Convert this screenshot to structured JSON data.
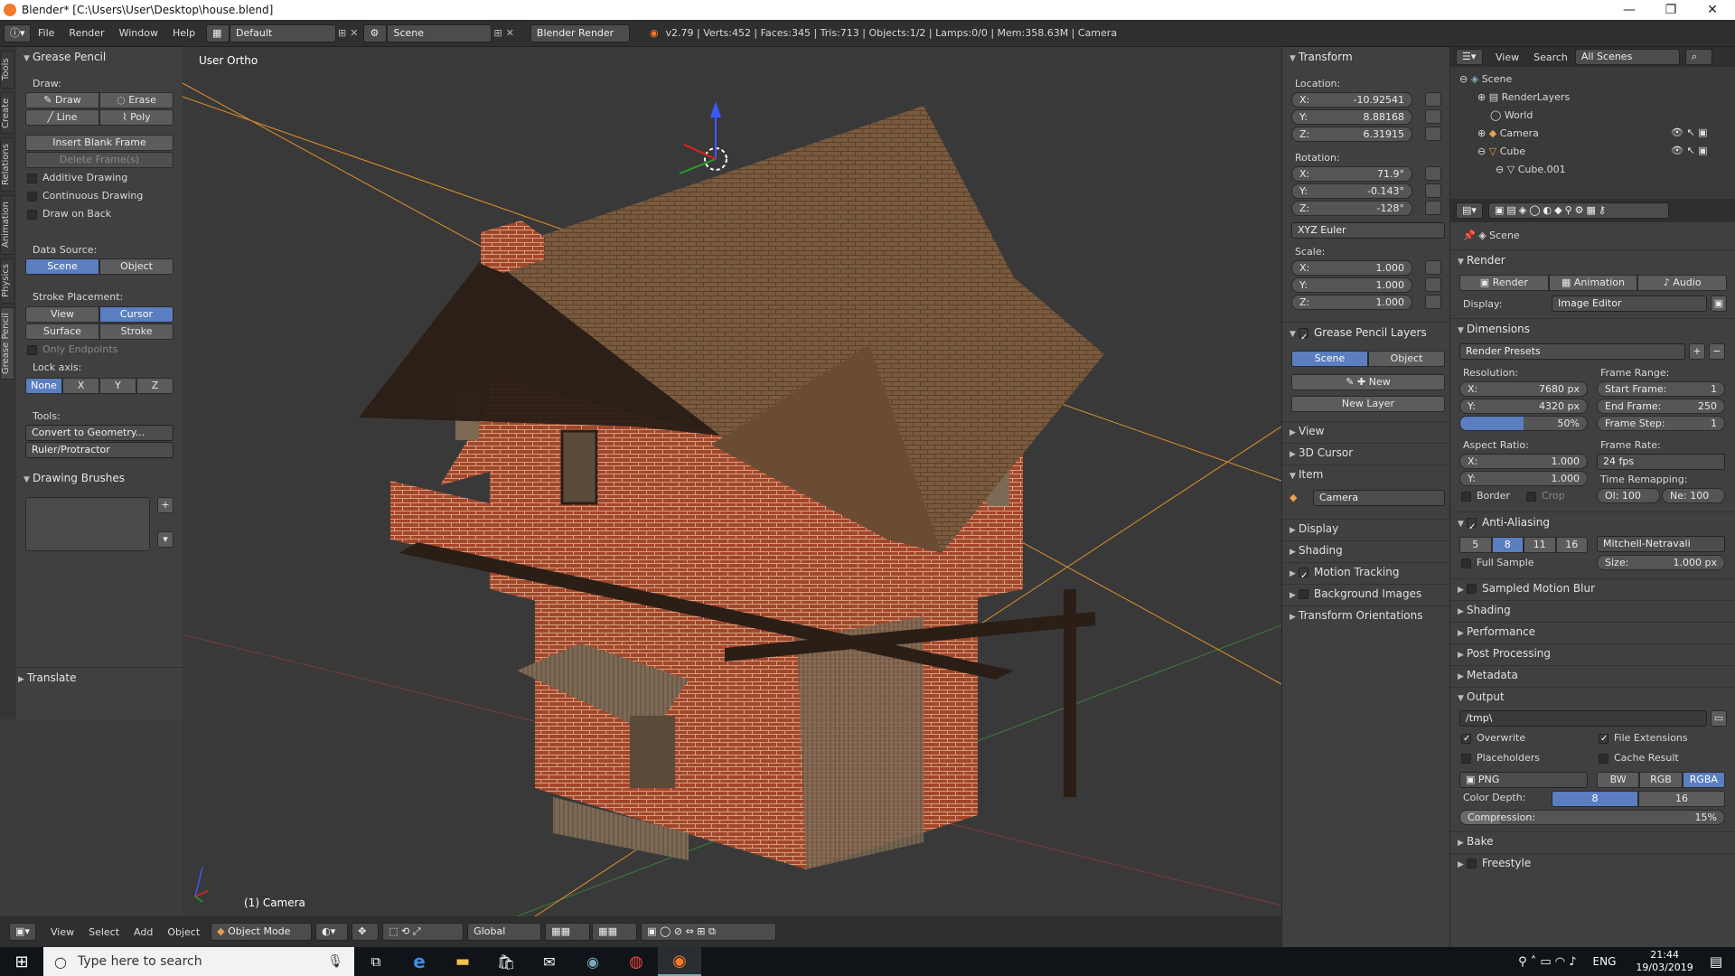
{
  "window": {
    "title": "Blender* [C:\\Users\\User\\Desktop\\house.blend]"
  },
  "menu": {
    "items": [
      "File",
      "Render",
      "Window",
      "Help"
    ],
    "layout": "Default",
    "scene": "Scene",
    "engine": "Blender Render",
    "stats": "v2.79 | Verts:452 | Faces:345 | Tris:713 | Objects:1/2 | Lamps:0/0 | Mem:358.63M | Camera"
  },
  "tabs": [
    "Tools",
    "Create",
    "Relations",
    "Animation",
    "Physics",
    "Grease Pencil"
  ],
  "tool": {
    "title": "Grease Pencil",
    "draw": "Draw:",
    "draw_btn": "Draw",
    "erase_btn": "Erase",
    "line_btn": "Line",
    "poly_btn": "Poly",
    "insert": "Insert Blank Frame",
    "delete": "Delete Frame(s)",
    "additive": "Additive Drawing",
    "continuous": "Continuous Drawing",
    "onback": "Draw on Back",
    "datasource": "Data Source:",
    "ds_scene": "Scene",
    "ds_object": "Object",
    "stroke": "Stroke Placement:",
    "sp_view": "View",
    "sp_cursor": "Cursor",
    "sp_surface": "Surface",
    "sp_stroke": "Stroke",
    "endpoints": "Only Endpoints",
    "lockaxis": "Lock axis:",
    "la": [
      "None",
      "X",
      "Y",
      "Z"
    ],
    "tools": "Tools:",
    "convert": "Convert to Geometry...",
    "ruler": "Ruler/Protractor",
    "brushes": "Drawing Brushes",
    "translate": "Translate"
  },
  "viewport": {
    "view_name": "User Ortho",
    "object_name": "(1) Camera"
  },
  "bottombar": {
    "view": "View",
    "select": "Select",
    "add": "Add",
    "object": "Object",
    "mode": "Object Mode",
    "orient": "Global"
  },
  "transform": {
    "title": "Transform",
    "location": "Location:",
    "rotation": "Rotation:",
    "scale": "Scale:",
    "loc": [
      [
        "X:",
        "-10.92541"
      ],
      [
        "Y:",
        "8.88168"
      ],
      [
        "Z:",
        "6.31915"
      ]
    ],
    "rot": [
      [
        "X:",
        "71.9°"
      ],
      [
        "Y:",
        "-0.143°"
      ],
      [
        "Z:",
        "-128°"
      ]
    ],
    "euler": "XYZ Euler",
    "scl": [
      [
        "X:",
        "1.000"
      ],
      [
        "Y:",
        "1.000"
      ],
      [
        "Z:",
        "1.000"
      ]
    ],
    "gpl": "Grease Pencil Layers",
    "gpl_scene": "Scene",
    "gpl_object": "Object",
    "gpl_new": "New",
    "gpl_newlayer": "New Layer",
    "sections": [
      "View",
      "3D Cursor"
    ],
    "item": "Item",
    "item_name": "Camera",
    "sections2": [
      "Display",
      "Shading",
      "Motion Tracking",
      "Background Images",
      "Transform Orientations"
    ]
  },
  "outliner": {
    "view": "View",
    "search": "Search",
    "filter": "All Scenes",
    "rows": [
      "Scene",
      "RenderLayers",
      "World",
      "Camera",
      "Cube",
      "Cube.001"
    ]
  },
  "props": {
    "context": "Scene",
    "render": "Render",
    "render_btn": "Render",
    "anim_btn": "Animation",
    "audio_btn": "Audio",
    "display_lbl": "Display:",
    "display_val": "Image Editor",
    "dimensions": "Dimensions",
    "presets": "Render Presets",
    "resolution": "Resolution:",
    "res_x": "7680 px",
    "res_y": "4320 px",
    "res_pct": "50%",
    "frame_range": "Frame Range:",
    "start": "Start Frame:",
    "start_v": "1",
    "end": "End Frame:",
    "end_v": "250",
    "step": "Frame Step:",
    "step_v": "1",
    "aspect": "Aspect Ratio:",
    "asp_x": "1.000",
    "asp_y": "1.000",
    "frame_rate": "Frame Rate:",
    "fps": "24 fps",
    "time_remap": "Time Remapping:",
    "ol": "Ol: 100",
    "ne": "Ne: 100",
    "border": "Border",
    "crop": "Crop",
    "aa": "Anti-Aliasing",
    "aa_vals": [
      "5",
      "8",
      "11",
      "16"
    ],
    "filter": "Mitchell-Netravali",
    "full_sample": "Full Sample",
    "size": "Size:",
    "size_v": "1.000 px",
    "sections": [
      "Sampled Motion Blur",
      "Shading",
      "Performance",
      "Post Processing",
      "Metadata"
    ],
    "output": "Output",
    "path": "/tmp\\",
    "overwrite": "Overwrite",
    "file_ext": "File Extensions",
    "placeholders": "Placeholders",
    "cache": "Cache Result",
    "format": "PNG",
    "bw": "BW",
    "rgb": "RGB",
    "rgba": "RGBA",
    "color_depth": "Color Depth:",
    "cd8": "8",
    "cd16": "16",
    "compression": "Compression:",
    "comp_v": "15%",
    "bake": "Bake",
    "freestyle": "Freestyle"
  },
  "taskbar": {
    "search": "Type here to search",
    "lang": "ENG",
    "time": "21:44",
    "date": "19/03/2019"
  }
}
